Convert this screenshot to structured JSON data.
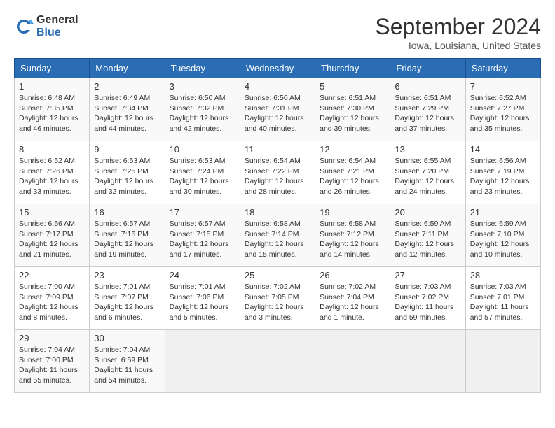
{
  "header": {
    "logo_general": "General",
    "logo_blue": "Blue",
    "title": "September 2024",
    "subtitle": "Iowa, Louisiana, United States"
  },
  "days_of_week": [
    "Sunday",
    "Monday",
    "Tuesday",
    "Wednesday",
    "Thursday",
    "Friday",
    "Saturday"
  ],
  "weeks": [
    [
      {
        "day": "1",
        "info": "Sunrise: 6:48 AM\nSunset: 7:35 PM\nDaylight: 12 hours\nand 46 minutes."
      },
      {
        "day": "2",
        "info": "Sunrise: 6:49 AM\nSunset: 7:34 PM\nDaylight: 12 hours\nand 44 minutes."
      },
      {
        "day": "3",
        "info": "Sunrise: 6:50 AM\nSunset: 7:32 PM\nDaylight: 12 hours\nand 42 minutes."
      },
      {
        "day": "4",
        "info": "Sunrise: 6:50 AM\nSunset: 7:31 PM\nDaylight: 12 hours\nand 40 minutes."
      },
      {
        "day": "5",
        "info": "Sunrise: 6:51 AM\nSunset: 7:30 PM\nDaylight: 12 hours\nand 39 minutes."
      },
      {
        "day": "6",
        "info": "Sunrise: 6:51 AM\nSunset: 7:29 PM\nDaylight: 12 hours\nand 37 minutes."
      },
      {
        "day": "7",
        "info": "Sunrise: 6:52 AM\nSunset: 7:27 PM\nDaylight: 12 hours\nand 35 minutes."
      }
    ],
    [
      {
        "day": "8",
        "info": "Sunrise: 6:52 AM\nSunset: 7:26 PM\nDaylight: 12 hours\nand 33 minutes."
      },
      {
        "day": "9",
        "info": "Sunrise: 6:53 AM\nSunset: 7:25 PM\nDaylight: 12 hours\nand 32 minutes."
      },
      {
        "day": "10",
        "info": "Sunrise: 6:53 AM\nSunset: 7:24 PM\nDaylight: 12 hours\nand 30 minutes."
      },
      {
        "day": "11",
        "info": "Sunrise: 6:54 AM\nSunset: 7:22 PM\nDaylight: 12 hours\nand 28 minutes."
      },
      {
        "day": "12",
        "info": "Sunrise: 6:54 AM\nSunset: 7:21 PM\nDaylight: 12 hours\nand 26 minutes."
      },
      {
        "day": "13",
        "info": "Sunrise: 6:55 AM\nSunset: 7:20 PM\nDaylight: 12 hours\nand 24 minutes."
      },
      {
        "day": "14",
        "info": "Sunrise: 6:56 AM\nSunset: 7:19 PM\nDaylight: 12 hours\nand 23 minutes."
      }
    ],
    [
      {
        "day": "15",
        "info": "Sunrise: 6:56 AM\nSunset: 7:17 PM\nDaylight: 12 hours\nand 21 minutes."
      },
      {
        "day": "16",
        "info": "Sunrise: 6:57 AM\nSunset: 7:16 PM\nDaylight: 12 hours\nand 19 minutes."
      },
      {
        "day": "17",
        "info": "Sunrise: 6:57 AM\nSunset: 7:15 PM\nDaylight: 12 hours\nand 17 minutes."
      },
      {
        "day": "18",
        "info": "Sunrise: 6:58 AM\nSunset: 7:14 PM\nDaylight: 12 hours\nand 15 minutes."
      },
      {
        "day": "19",
        "info": "Sunrise: 6:58 AM\nSunset: 7:12 PM\nDaylight: 12 hours\nand 14 minutes."
      },
      {
        "day": "20",
        "info": "Sunrise: 6:59 AM\nSunset: 7:11 PM\nDaylight: 12 hours\nand 12 minutes."
      },
      {
        "day": "21",
        "info": "Sunrise: 6:59 AM\nSunset: 7:10 PM\nDaylight: 12 hours\nand 10 minutes."
      }
    ],
    [
      {
        "day": "22",
        "info": "Sunrise: 7:00 AM\nSunset: 7:09 PM\nDaylight: 12 hours\nand 8 minutes."
      },
      {
        "day": "23",
        "info": "Sunrise: 7:01 AM\nSunset: 7:07 PM\nDaylight: 12 hours\nand 6 minutes."
      },
      {
        "day": "24",
        "info": "Sunrise: 7:01 AM\nSunset: 7:06 PM\nDaylight: 12 hours\nand 5 minutes."
      },
      {
        "day": "25",
        "info": "Sunrise: 7:02 AM\nSunset: 7:05 PM\nDaylight: 12 hours\nand 3 minutes."
      },
      {
        "day": "26",
        "info": "Sunrise: 7:02 AM\nSunset: 7:04 PM\nDaylight: 12 hours\nand 1 minute."
      },
      {
        "day": "27",
        "info": "Sunrise: 7:03 AM\nSunset: 7:02 PM\nDaylight: 11 hours\nand 59 minutes."
      },
      {
        "day": "28",
        "info": "Sunrise: 7:03 AM\nSunset: 7:01 PM\nDaylight: 11 hours\nand 57 minutes."
      }
    ],
    [
      {
        "day": "29",
        "info": "Sunrise: 7:04 AM\nSunset: 7:00 PM\nDaylight: 11 hours\nand 55 minutes."
      },
      {
        "day": "30",
        "info": "Sunrise: 7:04 AM\nSunset: 6:59 PM\nDaylight: 11 hours\nand 54 minutes."
      },
      {
        "day": "",
        "info": ""
      },
      {
        "day": "",
        "info": ""
      },
      {
        "day": "",
        "info": ""
      },
      {
        "day": "",
        "info": ""
      },
      {
        "day": "",
        "info": ""
      }
    ]
  ]
}
